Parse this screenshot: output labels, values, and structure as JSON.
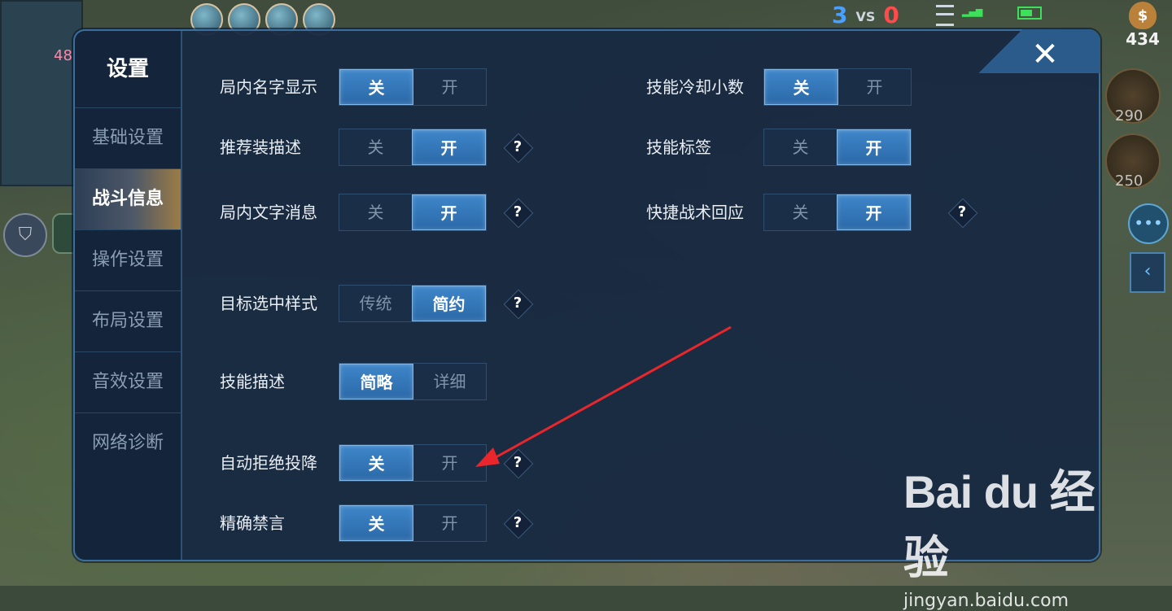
{
  "hud": {
    "score_blue": "3",
    "vs": "VS",
    "score_red": "0",
    "minimap_number": "48",
    "gold_icon": "$",
    "gold": "434",
    "item1_price": "290",
    "item2_price": "250",
    "chat_icon": "speech-bubble-icon",
    "collapse_icon": "chevron-left-icon"
  },
  "settings": {
    "title": "设置",
    "close_symbol": "✕",
    "sidebar": [
      {
        "label": "基础设置",
        "active": false
      },
      {
        "label": "战斗信息",
        "active": true
      },
      {
        "label": "操作设置",
        "active": false
      },
      {
        "label": "布局设置",
        "active": false
      },
      {
        "label": "音效设置",
        "active": false
      },
      {
        "label": "网络诊断",
        "active": false
      }
    ],
    "help_symbol": "?",
    "rows": [
      {
        "label": "局内名字显示",
        "options": [
          "关",
          "开"
        ],
        "selected": 0,
        "help": false
      },
      {
        "label": "技能冷却小数",
        "options": [
          "关",
          "开"
        ],
        "selected": 0,
        "help": false
      },
      {
        "label": "推荐装描述",
        "options": [
          "关",
          "开"
        ],
        "selected": 1,
        "help": true
      },
      {
        "label": "技能标签",
        "options": [
          "关",
          "开"
        ],
        "selected": 1,
        "help": false
      },
      {
        "label": "局内文字消息",
        "options": [
          "关",
          "开"
        ],
        "selected": 1,
        "help": true
      },
      {
        "label": "快捷战术回应",
        "options": [
          "关",
          "开"
        ],
        "selected": 1,
        "help": true
      },
      {
        "label": "目标选中样式",
        "options": [
          "传统",
          "简约"
        ],
        "selected": 1,
        "help": true
      },
      {
        "label": "技能描述",
        "options": [
          "简略",
          "详细"
        ],
        "selected": 0,
        "help": false
      },
      {
        "label": "自动拒绝投降",
        "options": [
          "关",
          "开"
        ],
        "selected": 0,
        "help": true
      },
      {
        "label": "精确禁言",
        "options": [
          "关",
          "开"
        ],
        "selected": 0,
        "help": true
      }
    ]
  },
  "watermark": {
    "logo": "Bai du 经验",
    "url": "jingyan.baidu.com"
  },
  "colors": {
    "panel_bg": "#182a42",
    "toggle_on": "#3e86c9",
    "annotation_arrow": "#e8262b"
  }
}
